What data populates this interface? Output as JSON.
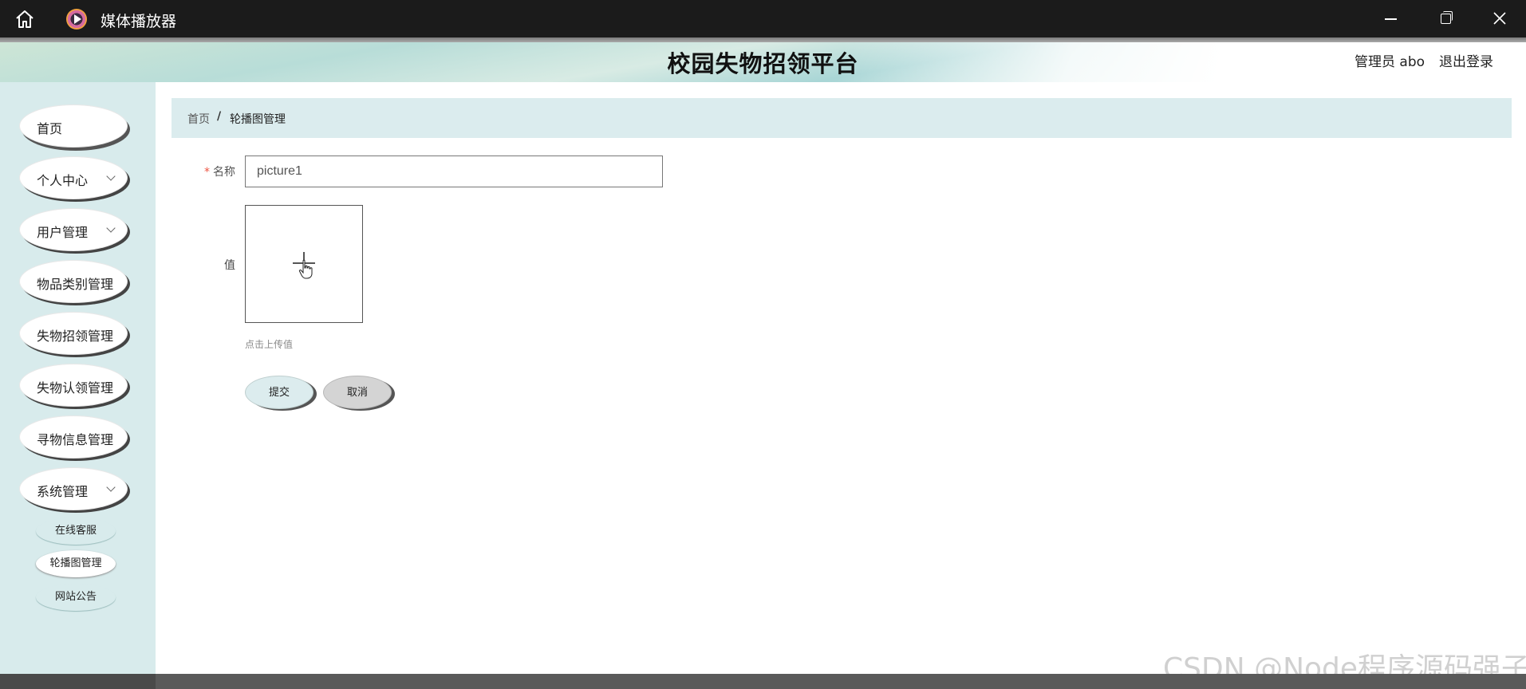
{
  "window": {
    "title": "媒体播放器",
    "icons": [
      "home-icon",
      "media-player-icon",
      "minimize-icon",
      "maximize-icon",
      "close-icon"
    ]
  },
  "header": {
    "title": "校园失物招领平台",
    "admin_label": "管理员 abo",
    "logout_label": "退出登录"
  },
  "sidebar": {
    "items": [
      {
        "label": "首页",
        "has_submenu": false
      },
      {
        "label": "个人中心",
        "has_submenu": true
      },
      {
        "label": "用户管理",
        "has_submenu": true
      },
      {
        "label": "物品类别管理",
        "has_submenu": false
      },
      {
        "label": "失物招领管理",
        "has_submenu": false
      },
      {
        "label": "失物认领管理",
        "has_submenu": false
      },
      {
        "label": "寻物信息管理",
        "has_submenu": false
      },
      {
        "label": "系统管理",
        "has_submenu": true
      }
    ],
    "subitems": [
      {
        "label": "在线客服",
        "active": false
      },
      {
        "label": "轮播图管理",
        "active": true
      },
      {
        "label": "网站公告",
        "active": false
      }
    ]
  },
  "breadcrumb": {
    "home": "首页",
    "separator": "/",
    "current": "轮播图管理"
  },
  "form": {
    "name_label": "名称",
    "name_required_mark": "*",
    "name_value": "picture1",
    "value_label": "值",
    "upload_hint": "点击上传值",
    "submit_label": "提交",
    "cancel_label": "取消"
  },
  "watermark": "CSDN @Node程序源码强子",
  "colors": {
    "titlebar": "#1b1b1b",
    "sidebar_bg": "#d8ebec",
    "breadcrumb_bg": "#dbecee",
    "required": "#ee5544"
  }
}
